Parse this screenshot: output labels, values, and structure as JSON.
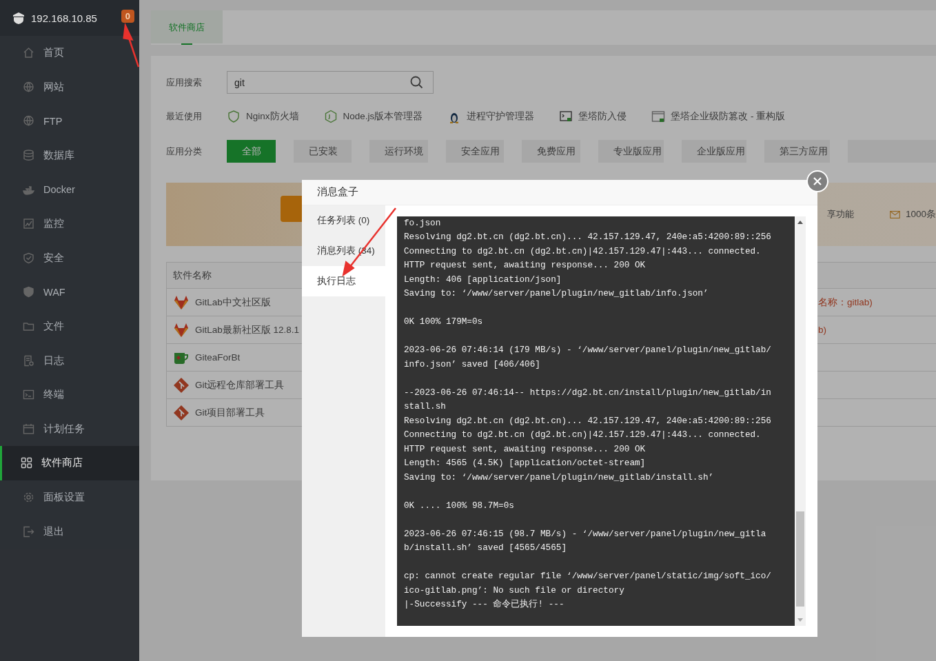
{
  "sidebar": {
    "host": "192.168.10.85",
    "badge": "0",
    "items": [
      {
        "label": "首页",
        "selected": false
      },
      {
        "label": "网站",
        "selected": false
      },
      {
        "label": "FTP",
        "selected": false
      },
      {
        "label": "数据库",
        "selected": false
      },
      {
        "label": "Docker",
        "selected": false
      },
      {
        "label": "监控",
        "selected": false
      },
      {
        "label": "安全",
        "selected": false
      },
      {
        "label": "WAF",
        "selected": false
      },
      {
        "label": "文件",
        "selected": false
      },
      {
        "label": "日志",
        "selected": false
      },
      {
        "label": "终端",
        "selected": false
      },
      {
        "label": "计划任务",
        "selected": false
      },
      {
        "label": "软件商店",
        "selected": true
      },
      {
        "label": "面板设置",
        "selected": false
      },
      {
        "label": "退出",
        "selected": false
      }
    ]
  },
  "tabs": [
    {
      "label": "软件商店",
      "selected": true
    }
  ],
  "search": {
    "label": "应用搜索",
    "value": "git"
  },
  "recent": {
    "label": "最近使用",
    "items": [
      "Nginx防火墙",
      "Node.js版本管理器",
      "进程守护管理器",
      "堡塔防入侵",
      "堡塔企业级防篡改 - 重构版"
    ]
  },
  "categories": {
    "label": "应用分类",
    "items": [
      {
        "label": "全部",
        "selected": true
      },
      {
        "label": "已安装",
        "selected": false
      },
      {
        "label": "运行环境",
        "selected": false
      },
      {
        "label": "安全应用",
        "selected": false
      },
      {
        "label": "免费应用",
        "selected": false
      },
      {
        "label": "专业版应用",
        "selected": false
      },
      {
        "label": "企业版应用",
        "selected": false
      },
      {
        "label": "第三方应用",
        "selected": false
      }
    ]
  },
  "banner": {
    "feature": "享功能",
    "sms": "1000条"
  },
  "table": {
    "columns": [
      "软件名称"
    ],
    "rows": [
      {
        "name": "GitLab中文社区版",
        "column_2": "名称：gitlab)"
      },
      {
        "name": "GitLab最新社区版 12.8.1",
        "column_2": "b)"
      },
      {
        "name": "GiteaForBt"
      },
      {
        "name": "Git远程仓库部署工具"
      },
      {
        "name": "Git项目部署工具"
      }
    ]
  },
  "dialog": {
    "title": "消息盒子",
    "tabs": [
      {
        "label": "任务列表 (0)",
        "selected": false
      },
      {
        "label": "消息列表 (34)",
        "selected": false
      },
      {
        "label": "执行日志",
        "selected": true
      }
    ],
    "log": [
      [
        "fo.json",
        "Resolving dg2.bt.cn (dg2.bt.cn)... 42.157.129.47, 240e:a5:4200:89::256",
        "Connecting to dg2.bt.cn (dg2.bt.cn)|42.157.129.47|:443... connected.",
        "HTTP request sent, awaiting response... 200 OK",
        "Length: 406 [application/json]",
        "Saving to: ‘/www/server/panel/plugin/new_gitlab/info.json’"
      ],
      [
        "0K 100% 179M=0s"
      ],
      [
        "2023-06-26 07:46:14 (179 MB/s) - ‘/www/server/panel/plugin/new_gitlab/",
        "info.json’ saved [406/406]"
      ],
      [
        "--2023-06-26 07:46:14-- https://dg2.bt.cn/install/plugin/new_gitlab/in",
        "stall.sh",
        "Resolving dg2.bt.cn (dg2.bt.cn)... 42.157.129.47, 240e:a5:4200:89::256",
        "Connecting to dg2.bt.cn (dg2.bt.cn)|42.157.129.47|:443... connected.",
        "HTTP request sent, awaiting response... 200 OK",
        "Length: 4565 (4.5K) [application/octet-stream]",
        "Saving to: ‘/www/server/panel/plugin/new_gitlab/install.sh’"
      ],
      [
        "0K .... 100% 98.7M=0s"
      ],
      [
        "2023-06-26 07:46:15 (98.7 MB/s) - ‘/www/server/panel/plugin/new_gitla",
        "b/install.sh’ saved [4565/4565]"
      ],
      [
        "cp: cannot create regular file ‘/www/server/panel/static/img/soft_ico/",
        "ico-gitlab.png’: No such file or directory",
        "|-Successify --- 命令已执行! ---"
      ]
    ]
  }
}
